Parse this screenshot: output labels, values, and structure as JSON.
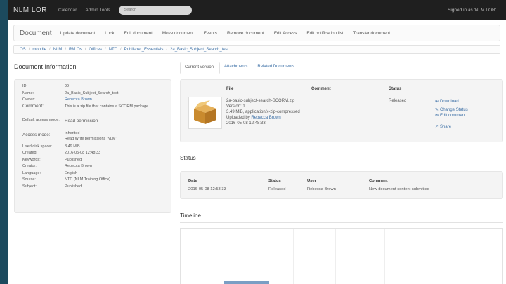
{
  "navbar": {
    "brand": "NLM LOR",
    "links": [
      "Calendar",
      "Admin Tools"
    ],
    "search_placeholder": "Search",
    "signed_in": "Signed in as 'NLM LOR'"
  },
  "toolbar": {
    "title": "Document",
    "items": [
      "Update document",
      "Lock",
      "Edit document",
      "Move document",
      "Events",
      "Remove document",
      "Edit Access",
      "Edit notification list",
      "Transfer document"
    ]
  },
  "breadcrumb": [
    "OS",
    "moodle",
    "NLM",
    "RM Os",
    "Offices",
    "NTC",
    "Publisher_Essentials",
    "2a_Basic_Subject_Search_test"
  ],
  "document_info": {
    "heading": "Document Information",
    "rows": [
      {
        "label": "ID:",
        "value": "99"
      },
      {
        "label": "Name:",
        "value": "2a_Basic_Subject_Search_test"
      },
      {
        "label": "Owner:",
        "value": "Rebecca Brown",
        "link": true
      },
      {
        "label": "Comment:",
        "value": "This is a zip file that contains a SCORM package"
      },
      {
        "label": "Default access mode:",
        "value": "Read permission"
      },
      {
        "label": "Access mode:",
        "value": "Inherited\nRead Write permissions 'NLM'"
      },
      {
        "label": "Used disk space:",
        "value": "3.49 MiB"
      },
      {
        "label": "Created:",
        "value": "2016-05-08 12:48:33"
      },
      {
        "label": "Keywords:",
        "value": "Published"
      },
      {
        "label": "Creator:",
        "value": "Rebecca Brown"
      },
      {
        "label": "Language:",
        "value": "English"
      },
      {
        "label": "Source:",
        "value": "NTC (NLM Training Office)"
      },
      {
        "label": "Subject:",
        "value": "Published"
      }
    ]
  },
  "tabs": [
    "Current version",
    "Attachments",
    "Related Documents"
  ],
  "file": {
    "headers": {
      "file": "File",
      "comment": "Comment",
      "status": "Status"
    },
    "name": "2a-basic-subject-search-SCORM.zip",
    "version": "Version: 1",
    "size_type": "3.49 MiB, application/x-zip-compressed",
    "uploaded_prefix": "Uploaded by ",
    "uploaded_by": "Rebecca Brown",
    "date": "2016-05-08 12:48:33",
    "status": "Released",
    "actions": {
      "download": "Download",
      "change_status": "Change Status",
      "edit_comment": "Edit comment",
      "share": "Share"
    }
  },
  "status_section": {
    "heading": "Status",
    "headers": [
      "Date",
      "Status",
      "User",
      "Comment"
    ],
    "row": [
      "2016-05-08 12:53:33",
      "Released",
      "Rebecca Brown",
      "New document content submitted"
    ]
  },
  "timeline": {
    "heading": "Timeline"
  },
  "colors": {
    "navbar": "#1f1f1f",
    "link": "#3a6ea5",
    "panel": "#f4f4f4",
    "sidebar": "#1c4a5e"
  }
}
